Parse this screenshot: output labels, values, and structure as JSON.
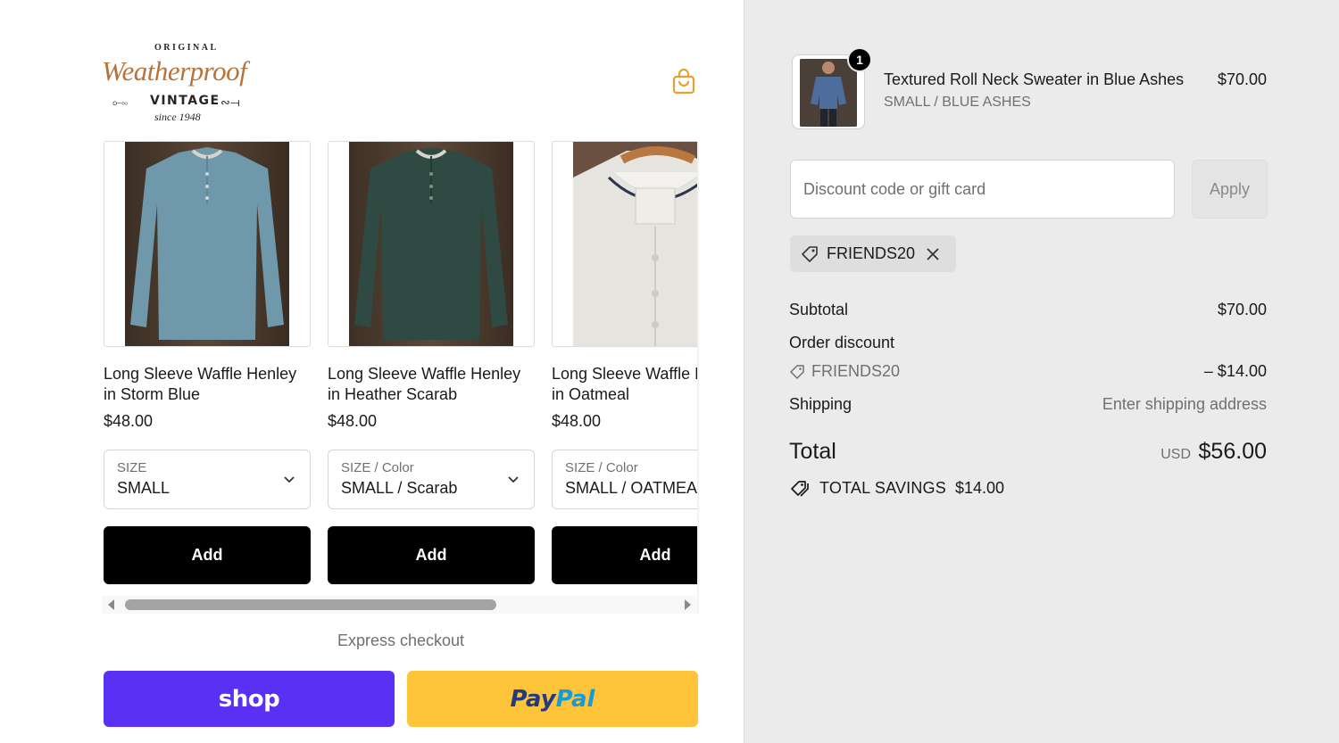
{
  "store": {
    "logo": {
      "original": "ORIGINAL",
      "script": "Weatherproof",
      "vintage": "VINTAGE",
      "since": "since 1948"
    },
    "cart_icon": "shopping-bag-icon"
  },
  "upsell": {
    "products": [
      {
        "title_line1": "Long Sleeve Waffle Henley",
        "title_line2": "in Storm Blue",
        "price": "$48.00",
        "select_label": "SIZE",
        "select_value": "SMALL",
        "add_label": "Add",
        "shirt_color": "#6f98ab"
      },
      {
        "title_line1": "Long Sleeve Waffle Henley",
        "title_line2": "in Heather Scarab",
        "price": "$48.00",
        "select_label": "SIZE / Color",
        "select_value": "SMALL / Scarab",
        "add_label": "Add",
        "shirt_color": "#2f4a42"
      },
      {
        "title_line1": "Long Sleeve Waffle Henley",
        "title_line2": "in Oatmeal",
        "price": "$48.00",
        "select_label": "SIZE / Color",
        "select_value": "SMALL / OATMEAL",
        "add_label": "Add",
        "shirt_color": "#e4e2dd"
      }
    ]
  },
  "express": {
    "label": "Express checkout",
    "shop_label": "shop",
    "paypal_part1": "Pay",
    "paypal_part2": "Pal"
  },
  "order": {
    "item": {
      "quantity": "1",
      "title": "Textured Roll Neck Sweater in Blue Ashes",
      "variant": "SMALL / BLUE ASHES",
      "price": "$70.00"
    },
    "discount": {
      "placeholder": "Discount code or gift card",
      "apply_label": "Apply",
      "applied_code": "FRIENDS20"
    },
    "summary": {
      "subtotal_label": "Subtotal",
      "subtotal_value": "$70.00",
      "order_discount_label": "Order discount",
      "discount_code": "FRIENDS20",
      "discount_value": "– $14.00",
      "shipping_label": "Shipping",
      "shipping_value": "Enter shipping address",
      "total_label": "Total",
      "currency": "USD",
      "total_value": "$56.00",
      "savings_label": "TOTAL SAVINGS",
      "savings_value": "$14.00"
    }
  },
  "colors": {
    "shop_pay": "#5a31f4",
    "paypal": "#ffc439",
    "summary_bg": "#ebebeb",
    "add_button": "#000000"
  }
}
